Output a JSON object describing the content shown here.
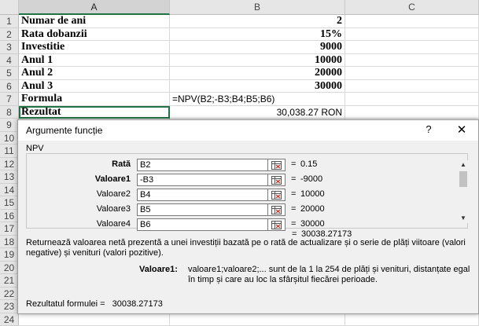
{
  "sheet": {
    "columns": [
      "A",
      "B",
      "C"
    ],
    "rows": [
      {
        "num": "1",
        "a": "Numar de ani",
        "b": "2"
      },
      {
        "num": "2",
        "a": "Rata dobanzii",
        "b": "15%"
      },
      {
        "num": "3",
        "a": "Investitie",
        "b": "9000"
      },
      {
        "num": "4",
        "a": "Anul 1",
        "b": "10000"
      },
      {
        "num": "5",
        "a": "Anul 2",
        "b": "20000"
      },
      {
        "num": "6",
        "a": "Anul 3",
        "b": "30000"
      },
      {
        "num": "7",
        "a": "Formula",
        "b": "=NPV(B2;-B3;B4;B5;B6)"
      },
      {
        "num": "8",
        "a": "Rezultat",
        "b": "30,038.27 RON"
      }
    ],
    "extra_row_numbers": [
      "9",
      "10",
      "11",
      "12",
      "13",
      "14",
      "15",
      "16",
      "17",
      "18",
      "19",
      "20",
      "21",
      "22",
      "23",
      "24"
    ]
  },
  "dialog": {
    "title": "Argumente funcție",
    "help_glyph": "?",
    "close_glyph": "✕",
    "function_name": "NPV",
    "arguments": [
      {
        "label": "Rată",
        "value": "B2",
        "result": "0.15",
        "bold": true
      },
      {
        "label": "Valoare1",
        "value": "-B3",
        "result": "-9000",
        "bold": true
      },
      {
        "label": "Valoare2",
        "value": "B4",
        "result": "10000",
        "bold": false
      },
      {
        "label": "Valoare3",
        "value": "B5",
        "result": "20000",
        "bold": false
      },
      {
        "label": "Valoare4",
        "value": "B6",
        "result": "30000",
        "bold": false
      }
    ],
    "equals": "=",
    "total_value": "30038.27173",
    "description": "Returnează valoarea netă prezentă a unei investiții bazată pe o rată de actualizare și o serie de plăți viitoare (valori negative) și venituri (valori pozitive).",
    "arg_help_label": "Valoare1:",
    "arg_help_text": "valoare1;valoare2;... sunt de la 1 la 254 de plăți și venituri, distanțate egal în timp și care au loc la sfârșitul fiecărei perioade.",
    "result_label": "Rezultatul formulei =",
    "result_value": "30038.27173"
  },
  "colors": {
    "selection": "#217346",
    "header_bg": "#e6e6e6",
    "dialog_bg": "#f0f0f0"
  },
  "icons": [
    "range-select-icon",
    "scroll-up-icon",
    "scroll-down-icon",
    "close-icon",
    "help-icon"
  ]
}
